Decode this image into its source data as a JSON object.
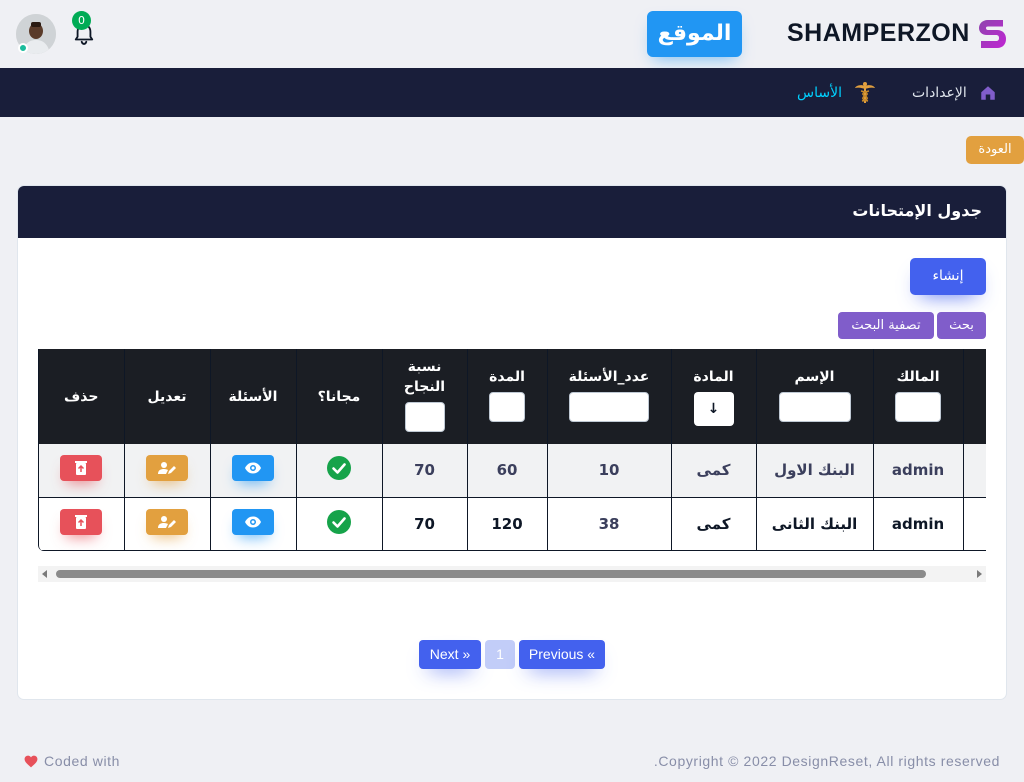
{
  "header": {
    "brand": "SHAMPERZON",
    "site_button": "الموقع",
    "notification_count": "0"
  },
  "nav": {
    "items": [
      {
        "label": "الإعدادات",
        "icon": "home-icon"
      },
      {
        "label": "الأساس",
        "icon": "caduceus-icon"
      }
    ]
  },
  "back_button": "العودة",
  "card": {
    "title": "جدول الإمتحانات",
    "create_button": "إنشاء",
    "search_button": "بحث",
    "filter_button": "تصفية البحث"
  },
  "table": {
    "columns": [
      "المالك",
      "الإسم",
      "المادة",
      "عدد_الأسئلة",
      "المدة",
      "نسبة النجاح",
      "مجانا؟",
      "الأسئلة",
      "تعديل",
      "حذف"
    ],
    "rows": [
      {
        "owner": "admin",
        "name": "البنك الاول",
        "subject": "كمى",
        "questions_count": "10",
        "duration": "60",
        "pass_rate": "70",
        "free": true
      },
      {
        "owner": "admin",
        "name": "البنك الثانى",
        "subject": "كمى",
        "questions_count": "38",
        "duration": "120",
        "pass_rate": "70",
        "free": true
      }
    ],
    "subject_select_arrow": "↓"
  },
  "pagination": {
    "next": "Next »",
    "current": "1",
    "previous": "Previous «"
  },
  "footer": {
    "copyright": "Copyright © 2022 DesignReset, All rights reserved.",
    "coded_with": "Coded with"
  },
  "colors": {
    "navbar": "#191e3a",
    "primary": "#4361ee",
    "info": "#2196f3",
    "warning": "#e2a03f",
    "danger": "#e7515a",
    "secondary": "#805dca",
    "success": "#00ab55"
  }
}
